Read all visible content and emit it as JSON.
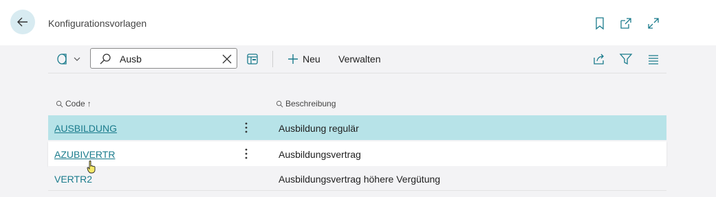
{
  "header": {
    "title": "Konfigurationsvorlagen"
  },
  "toolbar": {
    "search_value": "Ausb",
    "new_label": "Neu",
    "manage_label": "Verwalten"
  },
  "columns": {
    "code": "Code",
    "code_sort": "↑",
    "description": "Beschreibung"
  },
  "rows": [
    {
      "code": "AUSBILDUNG",
      "description": "Ausbildung regulär",
      "selected": true
    },
    {
      "code": "AZUBIVERTR",
      "description": "Ausbildungsvertrag",
      "selected": false
    },
    {
      "code": "VERTR2",
      "description": "Ausbildungsvertrag höhere Vergütung",
      "selected": false
    }
  ],
  "colors": {
    "accent": "#1a7b8c",
    "selected_row": "#b7e3e8",
    "back_button_bg": "#d8ebf1"
  },
  "icons": [
    "back-arrow-icon",
    "bookmark-icon",
    "open-new-window-icon",
    "expand-icon",
    "filter-pane-icon",
    "chevron-down-icon",
    "search-icon",
    "clear-icon",
    "column-layout-icon",
    "plus-icon",
    "share-icon",
    "filter-icon",
    "list-view-icon",
    "row-menu-icon",
    "hand-cursor-icon"
  ]
}
